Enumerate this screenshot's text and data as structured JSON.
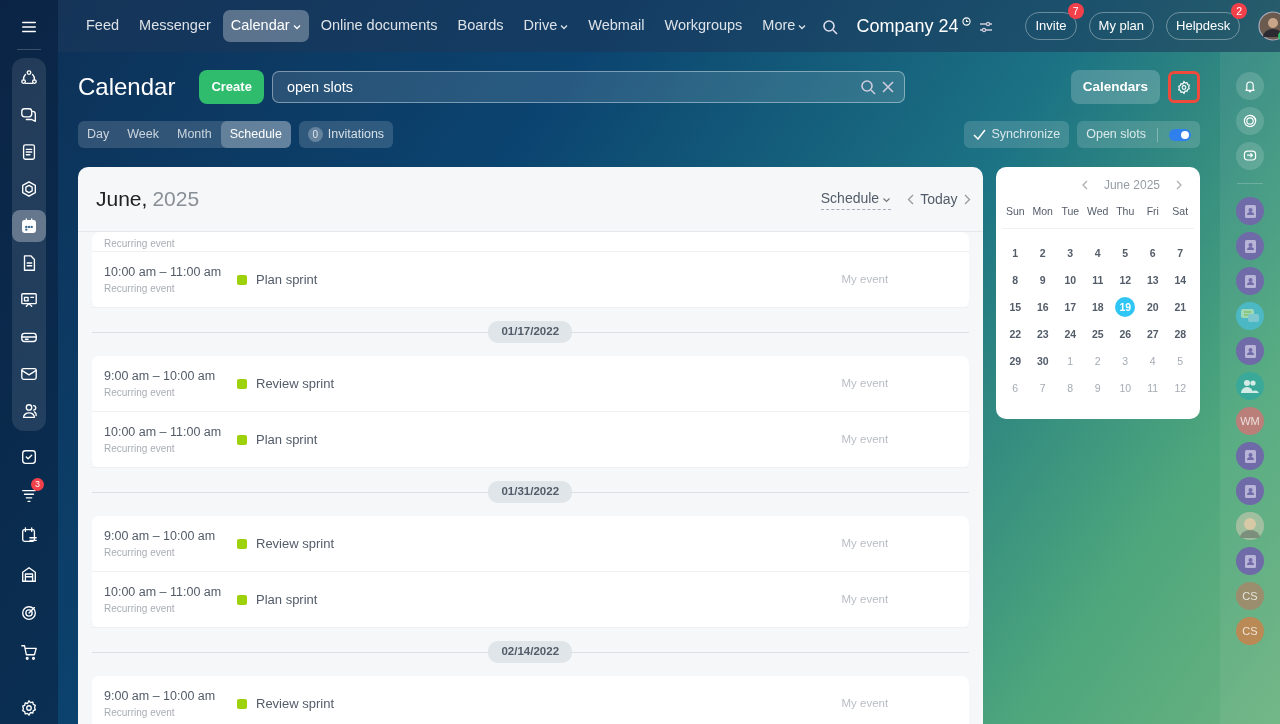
{
  "sidebar": {
    "items": [
      {
        "selected": false
      },
      {
        "selected": false
      },
      {
        "selected": false
      },
      {
        "selected": false
      },
      {
        "selected": true
      },
      {
        "selected": false
      },
      {
        "selected": false
      },
      {
        "selected": false
      },
      {
        "selected": false
      },
      {
        "selected": false
      },
      {
        "selected": false
      },
      {
        "selected": false,
        "badge": "3"
      },
      {
        "selected": false
      },
      {
        "selected": false
      },
      {
        "selected": false
      },
      {
        "selected": false
      },
      {
        "selected": false
      }
    ]
  },
  "top_nav": {
    "items": [
      {
        "label": "Feed",
        "selected": false,
        "dropdown": false
      },
      {
        "label": "Messenger",
        "selected": false,
        "dropdown": false
      },
      {
        "label": "Calendar",
        "selected": true,
        "dropdown": true
      },
      {
        "label": "Online documents",
        "selected": false,
        "dropdown": false
      },
      {
        "label": "Boards",
        "selected": false,
        "dropdown": false
      },
      {
        "label": "Drive",
        "selected": false,
        "dropdown": true
      },
      {
        "label": "Webmail",
        "selected": false,
        "dropdown": false
      },
      {
        "label": "Workgroups",
        "selected": false,
        "dropdown": false
      },
      {
        "label": "More",
        "selected": false,
        "dropdown": true
      }
    ],
    "company": "Company 24",
    "buttons": [
      {
        "label": "Invite",
        "badge": "7"
      },
      {
        "label": "My plan"
      },
      {
        "label": "Helpdesk",
        "badge": "2"
      }
    ]
  },
  "header": {
    "title": "Calendar",
    "create": "Create",
    "search": {
      "value": "open slots"
    },
    "calendars": "Calendars",
    "settings_highlighted": true
  },
  "view_tabs": [
    {
      "label": "Day",
      "selected": false
    },
    {
      "label": "Week",
      "selected": false
    },
    {
      "label": "Month",
      "selected": false
    },
    {
      "label": "Schedule",
      "selected": true
    }
  ],
  "invitations": {
    "count": "0",
    "label": "Invitations"
  },
  "synchronize": "Synchronize",
  "open_slots": {
    "label": "Open slots",
    "on": true
  },
  "schedule": {
    "month": "June,",
    "year": "2025",
    "view": "Schedule",
    "today": "Today",
    "groups": [
      {
        "events": [
          {
            "note": "Recurring event",
            "partial": true
          },
          {
            "time": "10:00 am – 11:00 am",
            "note": "Recurring event",
            "title": "Plan sprint",
            "color": "#9dd10a",
            "owner": "My event"
          }
        ]
      },
      {
        "date": "01/17/2022",
        "events": [
          {
            "time": "9:00 am – 10:00 am",
            "note": "Recurring event",
            "title": "Review sprint",
            "color": "#9dd10a",
            "owner": "My event"
          },
          {
            "time": "10:00 am – 11:00 am",
            "note": "Recurring event",
            "title": "Plan sprint",
            "color": "#9dd10a",
            "owner": "My event"
          }
        ]
      },
      {
        "date": "01/31/2022",
        "events": [
          {
            "time": "9:00 am – 10:00 am",
            "note": "Recurring event",
            "title": "Review sprint",
            "color": "#9dd10a",
            "owner": "My event"
          },
          {
            "time": "10:00 am – 11:00 am",
            "note": "Recurring event",
            "title": "Plan sprint",
            "color": "#9dd10a",
            "owner": "My event"
          }
        ]
      },
      {
        "date": "02/14/2022",
        "events": [
          {
            "time": "9:00 am – 10:00 am",
            "note": "Recurring event",
            "title": "Review sprint",
            "color": "#9dd10a",
            "owner": "My event"
          }
        ]
      }
    ]
  },
  "mini_calendar": {
    "title": "June 2025",
    "weekdays": [
      "Sun",
      "Mon",
      "Tue",
      "Wed",
      "Thu",
      "Fri",
      "Sat"
    ],
    "weeks": [
      [
        {
          "day": "1",
          "muted": false,
          "selected": false
        },
        {
          "day": "2",
          "muted": false,
          "selected": false
        },
        {
          "day": "3",
          "muted": false,
          "selected": false
        },
        {
          "day": "4",
          "muted": false,
          "selected": false
        },
        {
          "day": "5",
          "muted": false,
          "selected": false
        },
        {
          "day": "6",
          "muted": false,
          "selected": false
        },
        {
          "day": "7",
          "muted": false,
          "selected": false
        }
      ],
      [
        {
          "day": "8",
          "muted": false,
          "selected": false
        },
        {
          "day": "9",
          "muted": false,
          "selected": false
        },
        {
          "day": "10",
          "muted": false,
          "selected": false
        },
        {
          "day": "11",
          "muted": false,
          "selected": false
        },
        {
          "day": "12",
          "muted": false,
          "selected": false
        },
        {
          "day": "13",
          "muted": false,
          "selected": false
        },
        {
          "day": "14",
          "muted": false,
          "selected": false
        }
      ],
      [
        {
          "day": "15",
          "muted": false,
          "selected": false
        },
        {
          "day": "16",
          "muted": false,
          "selected": false
        },
        {
          "day": "17",
          "muted": false,
          "selected": false
        },
        {
          "day": "18",
          "muted": false,
          "selected": false
        },
        {
          "day": "19",
          "muted": false,
          "selected": true
        },
        {
          "day": "20",
          "muted": false,
          "selected": false
        },
        {
          "day": "21",
          "muted": false,
          "selected": false
        }
      ],
      [
        {
          "day": "22",
          "muted": false,
          "selected": false
        },
        {
          "day": "23",
          "muted": false,
          "selected": false
        },
        {
          "day": "24",
          "muted": false,
          "selected": false
        },
        {
          "day": "25",
          "muted": false,
          "selected": false
        },
        {
          "day": "26",
          "muted": false,
          "selected": false
        },
        {
          "day": "27",
          "muted": false,
          "selected": false
        },
        {
          "day": "28",
          "muted": false,
          "selected": false
        }
      ],
      [
        {
          "day": "29",
          "muted": false,
          "selected": false
        },
        {
          "day": "30",
          "muted": false,
          "selected": false
        },
        {
          "day": "1",
          "muted": true,
          "selected": false
        },
        {
          "day": "2",
          "muted": true,
          "selected": false
        },
        {
          "day": "3",
          "muted": true,
          "selected": false
        },
        {
          "day": "4",
          "muted": true,
          "selected": false
        },
        {
          "day": "5",
          "muted": true,
          "selected": false
        }
      ],
      [
        {
          "day": "6",
          "muted": true,
          "selected": false
        },
        {
          "day": "7",
          "muted": true,
          "selected": false
        },
        {
          "day": "8",
          "muted": true,
          "selected": false
        },
        {
          "day": "9",
          "muted": true,
          "selected": false
        },
        {
          "day": "10",
          "muted": true,
          "selected": false
        },
        {
          "day": "11",
          "muted": true,
          "selected": false
        },
        {
          "day": "12",
          "muted": true,
          "selected": false
        }
      ]
    ]
  },
  "right_rail": {
    "contacts": [
      {
        "kind": "contact"
      },
      {
        "kind": "contact"
      },
      {
        "kind": "contact"
      },
      {
        "kind": "chat"
      },
      {
        "kind": "contact"
      },
      {
        "kind": "group"
      },
      {
        "kind": "initials",
        "text": "WM",
        "color": "#b97f78"
      },
      {
        "kind": "contact"
      },
      {
        "kind": "contact"
      },
      {
        "kind": "photo"
      },
      {
        "kind": "contact"
      },
      {
        "kind": "initials",
        "text": "CS",
        "color": "#9b8e6e"
      },
      {
        "kind": "initials",
        "text": "CS",
        "color": "#b98a55"
      }
    ]
  }
}
